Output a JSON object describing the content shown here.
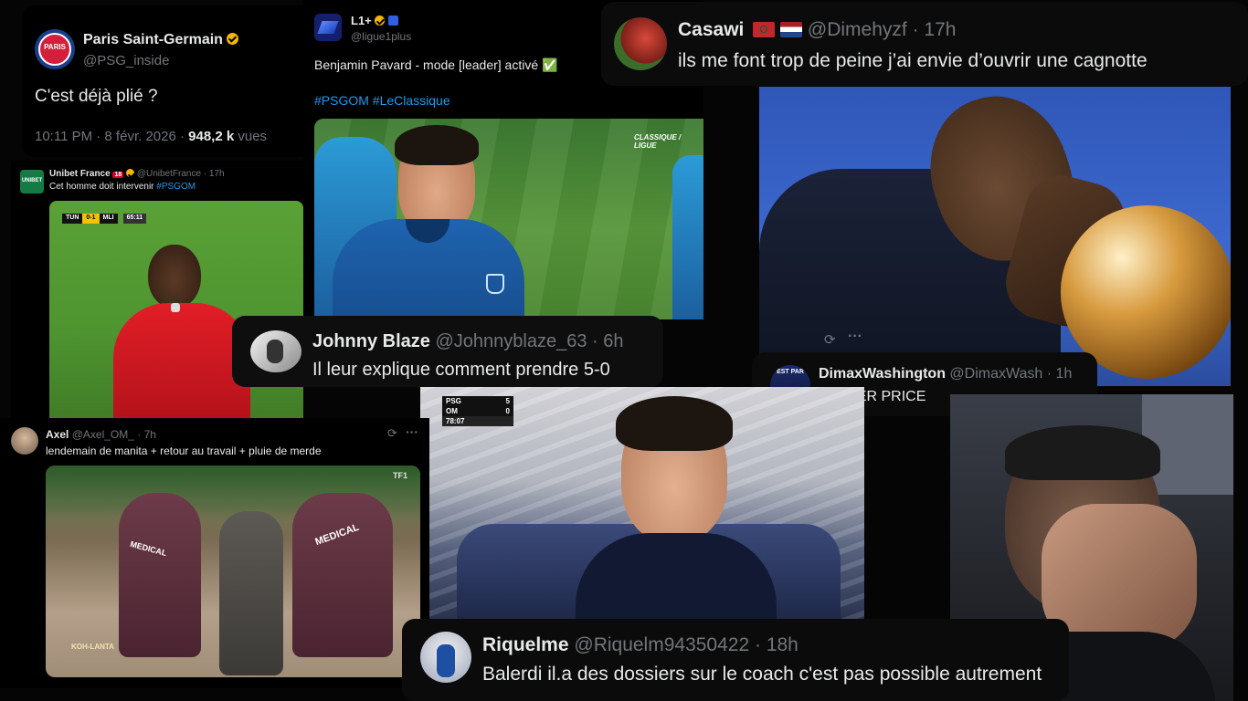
{
  "psg": {
    "name": "Paris Saint-Germain",
    "handle": "@PSG_inside",
    "text": "C'est déjà plié ?",
    "meta": "10:11 PM · 8 févr. 2026 ·",
    "views_count": "948,2 k",
    "views_label": "vues",
    "logo_text": "PARIS"
  },
  "ligue1": {
    "name": "L1+",
    "handle": "@ligue1plus",
    "text": "Benjamin Pavard - mode [leader] activé ✅",
    "hashtags": "#PSGOM #LeClassique",
    "broadcast_tag": "CLASSIQUE / LIGUE"
  },
  "casawi": {
    "name": "Casawi",
    "handle": "@Dimehyzf",
    "time": "· 17h",
    "text": "ils me font trop de peine j’ai envie d’ouvrir une cagnotte"
  },
  "unibet": {
    "logo_text": "UNIBET",
    "name": "Unibet France",
    "age_badge": "18",
    "handle": "@UnibetFrance · 17h",
    "text_main": "Cet homme doit intervenir ",
    "text_hashtag": "#PSGOM",
    "scoreboard": {
      "home": "TUN",
      "score": "0-1",
      "away": "MLI",
      "clock": "65:11"
    }
  },
  "johnny": {
    "name": "Johnny Blaze",
    "handle": "@Johnnyblaze_63",
    "time": "· 6h",
    "text": "Il leur explique comment prendre 5-0"
  },
  "dimax": {
    "avatar_text": "EST PAR",
    "name": "DimaxWashington",
    "handle": "@DimaxWash",
    "time": "· 1h",
    "text": "LEADER PRICE"
  },
  "axel": {
    "name": "Axel",
    "handle": "@Axel_OM_",
    "time": "· 7h",
    "text": "lendemain de manita + retour au travail + pluie de merde",
    "medical_label": "MEDICAL",
    "show_logo": "KOH-LANTA",
    "channel": "TF1"
  },
  "bench": {
    "scoreboard": {
      "team1": "PSG",
      "score1": "5",
      "team2": "OM",
      "score2": "0",
      "clock": "78:07"
    }
  },
  "riquelme": {
    "name": "Riquelme",
    "handle": "@Riquelm94350422",
    "time": "· 18h",
    "text": "Balerdi il.a des dossiers sur le coach c'est pas possible autrement"
  },
  "colors": {
    "background": "#050505",
    "card": "#000000",
    "text": "#e7e9ea",
    "muted": "#71767b",
    "link": "#1d9bf0",
    "verified_gold": "#f5b800",
    "om_blue": "#1e6fc4",
    "pitch_green": "#4b8b2c"
  }
}
